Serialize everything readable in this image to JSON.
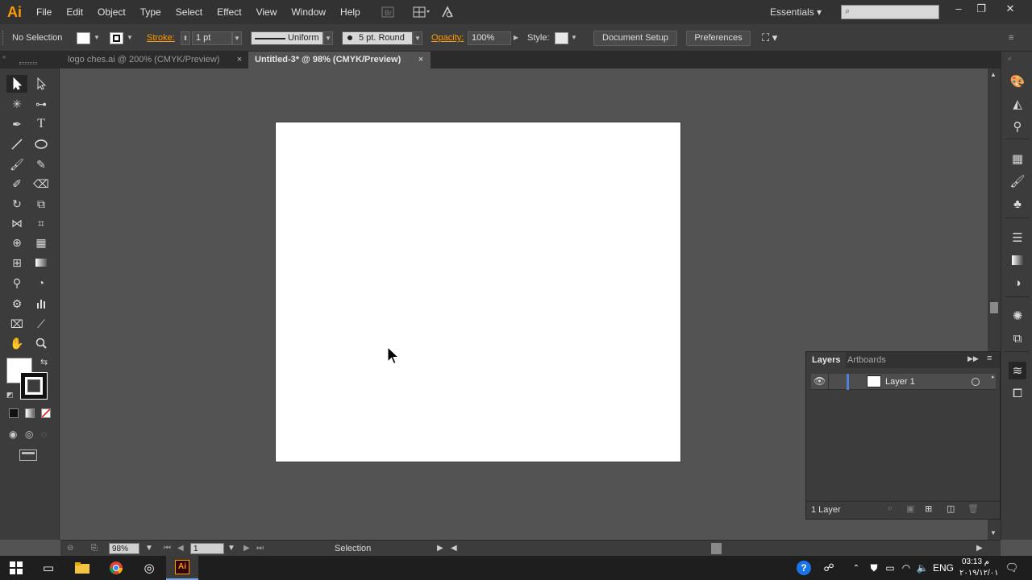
{
  "app": {
    "logo": "Ai"
  },
  "menu": [
    "File",
    "Edit",
    "Object",
    "Type",
    "Select",
    "Effect",
    "View",
    "Window",
    "Help"
  ],
  "menubar": {
    "workspace": "Essentials ▾",
    "search_placeholder": ""
  },
  "controlbar": {
    "selection_status": "No Selection",
    "stroke_label": "Stroke:",
    "stroke_weight": "1 pt",
    "profile": "Uniform",
    "brush": "5 pt. Round",
    "opacity_label": "Opacity:",
    "opacity_value": "100%",
    "style_label": "Style:",
    "doc_setup": "Document Setup",
    "preferences": "Preferences"
  },
  "tabs": [
    {
      "label": "logo ches.ai @ 200% (CMYK/Preview)",
      "active": false
    },
    {
      "label": "Untitled-3* @ 98% (CMYK/Preview)",
      "active": true
    }
  ],
  "layers_panel": {
    "tabs": [
      "Layers",
      "Artboards"
    ],
    "layer_name": "Layer 1",
    "count_text": "1 Layer"
  },
  "statusbar": {
    "zoom": "98%",
    "artboard_num": "1",
    "tool_name": "Selection"
  },
  "taskbar": {
    "language": "ENG",
    "time": "03:13 م",
    "date": "۲۰۱۹/۱۲/۰۱"
  },
  "colors": {
    "accent": "#ff9a00",
    "panel": "#3c3c3c",
    "canvas": "#535353",
    "artboard": "#ffffff"
  }
}
